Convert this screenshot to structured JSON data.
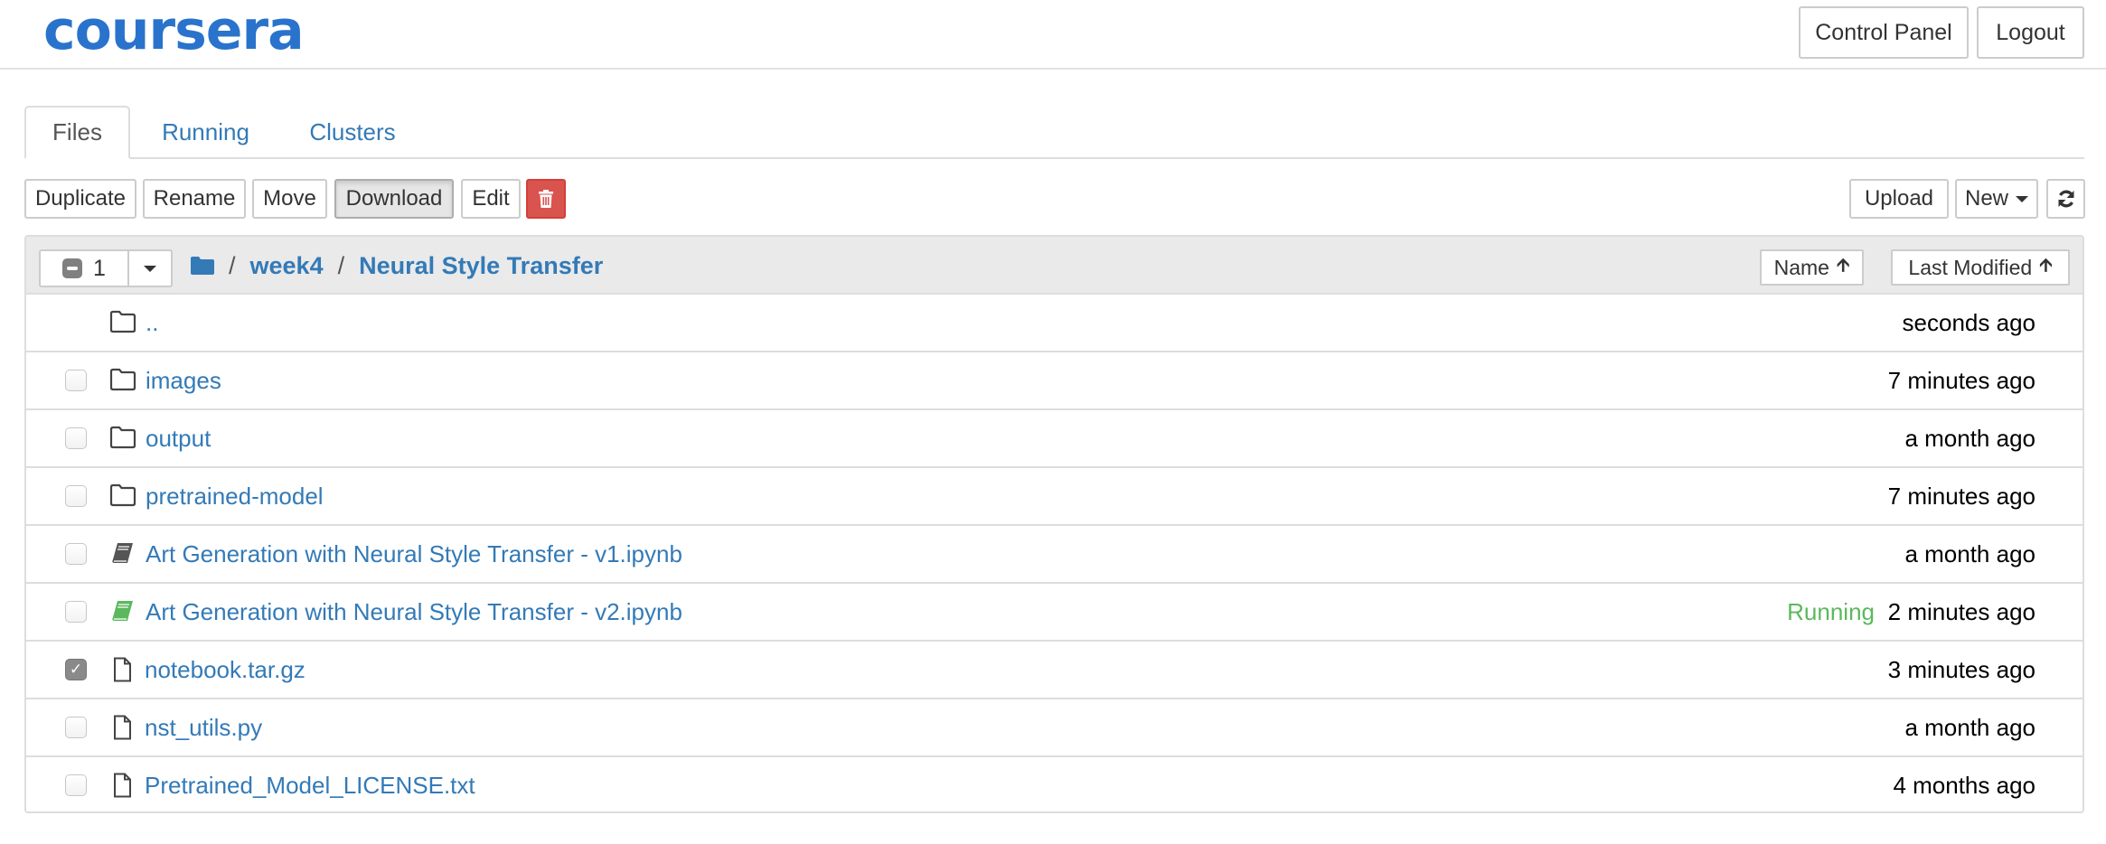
{
  "header": {
    "logo_text": "coursera",
    "buttons": {
      "control_panel": "Control Panel",
      "logout": "Logout"
    }
  },
  "tabs": [
    {
      "label": "Files",
      "active": true
    },
    {
      "label": "Running",
      "active": false
    },
    {
      "label": "Clusters",
      "active": false
    }
  ],
  "toolbar": {
    "duplicate": "Duplicate",
    "rename": "Rename",
    "move": "Move",
    "download": "Download",
    "edit": "Edit",
    "delete_icon": "trash-icon",
    "upload": "Upload",
    "new": "New",
    "refresh_icon": "refresh-icon"
  },
  "file_list": {
    "selected_count": "1",
    "breadcrumb": [
      "week4",
      "Neural Style Transfer"
    ],
    "breadcrumb_separator": "/",
    "sort": {
      "name": "Name",
      "last_modified": "Last Modified"
    },
    "rows": [
      {
        "name": "..",
        "type": "folder",
        "modified": "seconds ago",
        "checkbox": false,
        "checked": false,
        "status": ""
      },
      {
        "name": "images",
        "type": "folder",
        "modified": "7 minutes ago",
        "checkbox": true,
        "checked": false,
        "status": ""
      },
      {
        "name": "output",
        "type": "folder",
        "modified": "a month ago",
        "checkbox": true,
        "checked": false,
        "status": ""
      },
      {
        "name": "pretrained-model",
        "type": "folder",
        "modified": "7 minutes ago",
        "checkbox": true,
        "checked": false,
        "status": ""
      },
      {
        "name": "Art Generation with Neural Style Transfer - v1.ipynb",
        "type": "notebook",
        "modified": "a month ago",
        "checkbox": true,
        "checked": false,
        "status": ""
      },
      {
        "name": "Art Generation with Neural Style Transfer - v2.ipynb",
        "type": "notebook-running",
        "modified": "2 minutes ago",
        "checkbox": true,
        "checked": false,
        "status": "Running"
      },
      {
        "name": "notebook.tar.gz",
        "type": "file",
        "modified": "3 minutes ago",
        "checkbox": true,
        "checked": true,
        "status": ""
      },
      {
        "name": "nst_utils.py",
        "type": "file",
        "modified": "a month ago",
        "checkbox": true,
        "checked": false,
        "status": ""
      },
      {
        "name": "Pretrained_Model_LICENSE.txt",
        "type": "file",
        "modified": "4 months ago",
        "checkbox": true,
        "checked": false,
        "status": ""
      }
    ]
  },
  "colors": {
    "brand": "#2a73cc",
    "link": "#337ab7",
    "running": "#5cb85c",
    "danger": "#d9534f",
    "panel_header_bg": "#eaeaea"
  }
}
